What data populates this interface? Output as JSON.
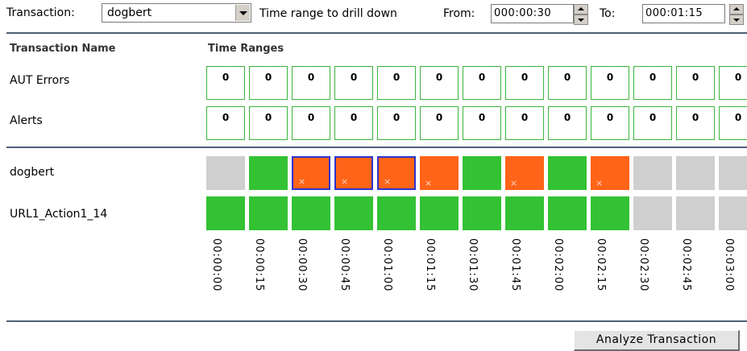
{
  "controls": {
    "transaction_label": "Transaction:",
    "transaction_value": "dogbert",
    "range_label": "Time range to drill down",
    "from_label": "From:",
    "from_value": "000:00:30",
    "to_label": "To:",
    "to_value": "000:01:15"
  },
  "headers": {
    "name": "Transaction Name",
    "ranges": "Time Ranges"
  },
  "rows": {
    "aut_errors": {
      "label": "AUT Errors",
      "values": [
        "0",
        "0",
        "0",
        "0",
        "0",
        "0",
        "0",
        "0",
        "0",
        "0",
        "0",
        "0",
        "0"
      ]
    },
    "alerts": {
      "label": "Alerts",
      "values": [
        "0",
        "0",
        "0",
        "0",
        "0",
        "0",
        "0",
        "0",
        "0",
        "0",
        "0",
        "0",
        "0"
      ]
    },
    "dogbert": {
      "label": "dogbert",
      "cells": [
        {
          "status": "gray",
          "selected": false,
          "x": false
        },
        {
          "status": "green",
          "selected": false,
          "x": false
        },
        {
          "status": "orange",
          "selected": true,
          "x": true
        },
        {
          "status": "orange",
          "selected": true,
          "x": true
        },
        {
          "status": "orange",
          "selected": true,
          "x": true
        },
        {
          "status": "orange",
          "selected": false,
          "x": true
        },
        {
          "status": "green",
          "selected": false,
          "x": false
        },
        {
          "status": "orange",
          "selected": false,
          "x": true
        },
        {
          "status": "green",
          "selected": false,
          "x": false
        },
        {
          "status": "orange",
          "selected": false,
          "x": true
        },
        {
          "status": "gray",
          "selected": false,
          "x": false
        },
        {
          "status": "gray",
          "selected": false,
          "x": false
        },
        {
          "status": "gray",
          "selected": false,
          "x": false
        }
      ]
    },
    "url1": {
      "label": "URL1_Action1_14",
      "cells": [
        "green",
        "green",
        "green",
        "green",
        "green",
        "green",
        "green",
        "green",
        "green",
        "green",
        "gray",
        "gray",
        "gray"
      ]
    }
  },
  "time_ticks": [
    "00:00:00",
    "00:00:15",
    "00:00:30",
    "00:00:45",
    "00:01:00",
    "00:01:15",
    "00:01:30",
    "00:01:45",
    "00:02:00",
    "00:02:15",
    "00:02:30",
    "00:02:45",
    "00:03:00"
  ],
  "error_mark": "×",
  "analyze_button": "Analyze Transaction",
  "colors": {
    "ok": "#33c233",
    "error": "#ff6418",
    "no_data": "#cfcfcf",
    "selected_border": "#2f34cc",
    "count_border": "#3cb43c",
    "rule": "#4d6077"
  }
}
